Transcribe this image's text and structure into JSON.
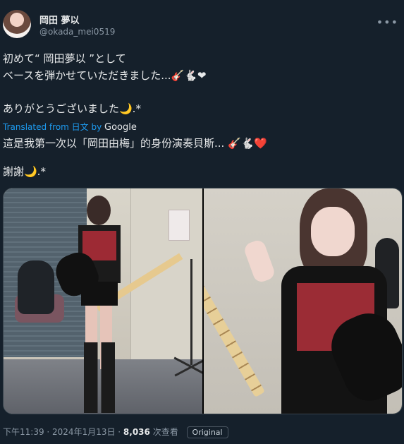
{
  "post": {
    "author_name": "岡田 夢以",
    "author_handle": "@okada_mei0519",
    "more_icon": "more-icon",
    "text_jp_line1": "初めて“ 岡田夢以 ”として",
    "text_jp_line2": "ベースを弾かせていただきました...🎸🐇❤",
    "text_jp_line3": "ありがとうございました🌙.*",
    "translated_prefix": "Translated from 日文 by ",
    "translated_brand": "Google",
    "text_zh_line1": "這是我第一次以「岡田由梅」的身份演奏貝斯... 🎸🐇❤️",
    "text_zh_line2": "謝謝🌙.*",
    "timestamp": "下午11:39 · 2024年1月13日 · ",
    "views_count": "8,036",
    "views_label": " 次查看",
    "original_label": "Original"
  }
}
